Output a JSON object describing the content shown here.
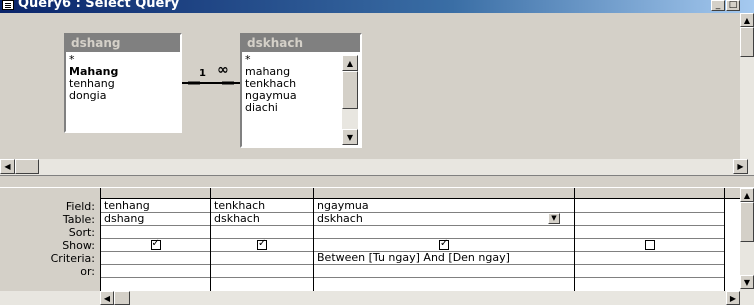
{
  "window": {
    "title": "Query6 : Select Query"
  },
  "tables": [
    {
      "name": "dshang",
      "fields": [
        "*",
        "Mahang",
        "tenhang",
        "dongia"
      ]
    },
    {
      "name": "dskhach",
      "fields": [
        "*",
        "mahang",
        "tenkhach",
        "ngaymua",
        "diachi"
      ]
    }
  ],
  "relationship": {
    "one": "1",
    "many": "∞"
  },
  "grid": {
    "row_labels": [
      "Field:",
      "Table:",
      "Sort:",
      "Show:",
      "Criteria:",
      "or:"
    ],
    "columns": [
      {
        "field": "tenhang",
        "table": "dshang",
        "sort": "",
        "show": true,
        "criteria": ""
      },
      {
        "field": "tenkhach",
        "table": "dskhach",
        "sort": "",
        "show": true,
        "criteria": ""
      },
      {
        "field": "ngaymua",
        "table": "dskhach",
        "sort": "",
        "show": true,
        "criteria": "Between [Tu ngay] And [Den ngay]"
      },
      {
        "field": "",
        "table": "",
        "sort": "",
        "show": false,
        "criteria": ""
      }
    ]
  }
}
